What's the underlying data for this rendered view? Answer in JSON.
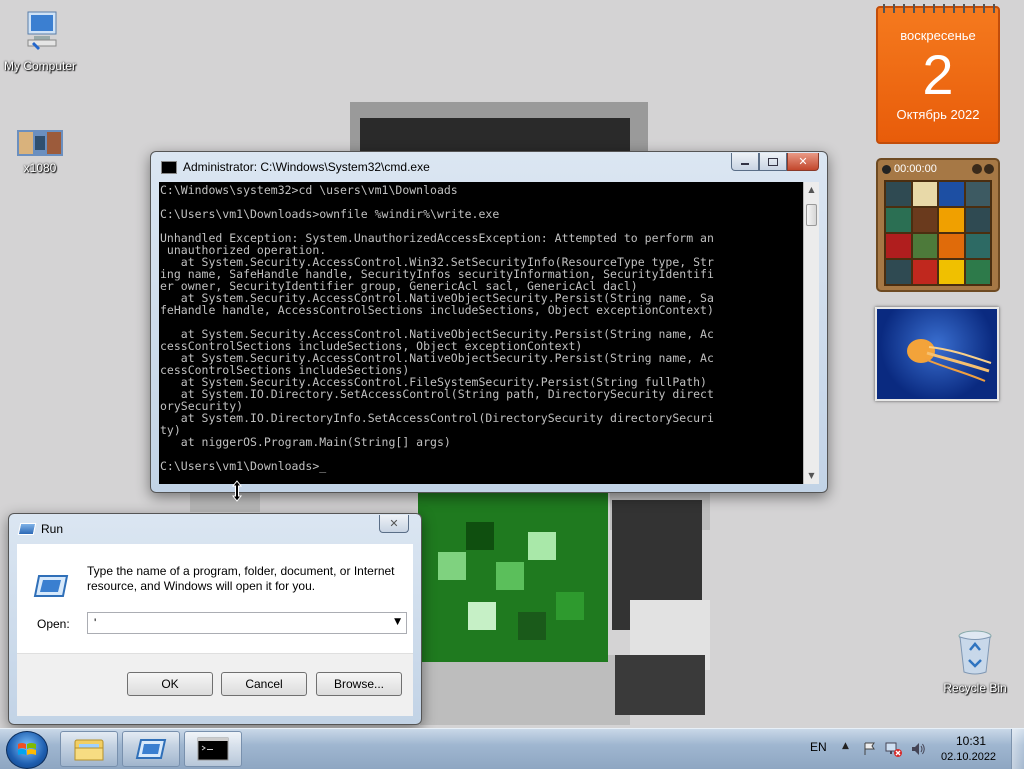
{
  "desktop": {
    "icons": [
      {
        "label": "My Computer"
      },
      {
        "label": "x1080"
      },
      {
        "label": "Recycle Bin"
      }
    ]
  },
  "gadgets": {
    "calendar": {
      "weekday": "воскресенье",
      "day": "2",
      "month_year": "Октябрь 2022"
    },
    "puzzle": {
      "timer": "00:00:00"
    }
  },
  "cmd": {
    "title": "Administrator: C:\\Windows\\System32\\cmd.exe",
    "lines": [
      "C:\\Windows\\system32>cd \\users\\vm1\\Downloads",
      "",
      "C:\\Users\\vm1\\Downloads>ownfile %windir%\\write.exe",
      "",
      "Unhandled Exception: System.UnauthorizedAccessException: Attempted to perform an",
      " unauthorized operation.",
      "   at System.Security.AccessControl.Win32.SetSecurityInfo(ResourceType type, Str",
      "ing name, SafeHandle handle, SecurityInfos securityInformation, SecurityIdentifi",
      "er owner, SecurityIdentifier group, GenericAcl sacl, GenericAcl dacl)",
      "   at System.Security.AccessControl.NativeObjectSecurity.Persist(String name, Sa",
      "feHandle handle, AccessControlSections includeSections, Object exceptionContext)",
      "",
      "   at System.Security.AccessControl.NativeObjectSecurity.Persist(String name, Ac",
      "cessControlSections includeSections, Object exceptionContext)",
      "   at System.Security.AccessControl.NativeObjectSecurity.Persist(String name, Ac",
      "cessControlSections includeSections)",
      "   at System.Security.AccessControl.FileSystemSecurity.Persist(String fullPath)",
      "   at System.IO.Directory.SetAccessControl(String path, DirectorySecurity direct",
      "orySecurity)",
      "   at System.IO.DirectoryInfo.SetAccessControl(DirectorySecurity directorySecuri",
      "ty)",
      "   at niggerOS.Program.Main(String[] args)",
      "",
      "C:\\Users\\vm1\\Downloads>_"
    ]
  },
  "run": {
    "title": "Run",
    "description": "Type the name of a program, folder, document, or Internet resource, and Windows will open it for you.",
    "open_label": "Open:",
    "open_value": "'",
    "ok": "OK",
    "cancel": "Cancel",
    "browse": "Browse..."
  },
  "taskbar": {
    "language": "EN",
    "time": "10:31",
    "date": "02.10.2022"
  },
  "colors": {
    "calendar": "#ef6a14",
    "taskbar": "#a9bdd4",
    "desktop": "#d4d3d4"
  }
}
